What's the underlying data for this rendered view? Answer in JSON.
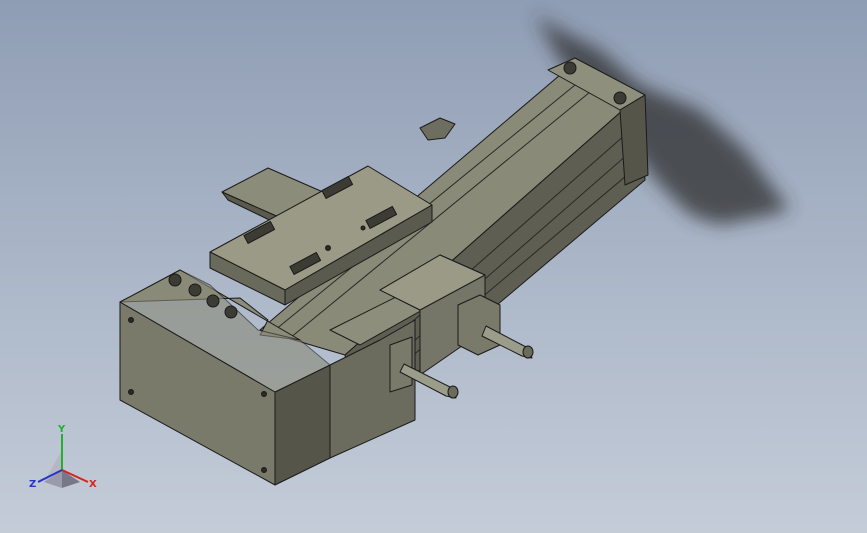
{
  "viewport": {
    "background_top": "#8f9db4",
    "background_bottom": "#c4ccd8"
  },
  "model": {
    "body_color": "#7c7c6c",
    "edge_color": "#1a1a1a",
    "shadow_color": "#3a3a3a"
  },
  "triad": {
    "x_label": "X",
    "y_label": "Y",
    "z_label": "Z",
    "x_color": "#d8231c",
    "y_color": "#23b02a",
    "z_color": "#2434c8"
  }
}
